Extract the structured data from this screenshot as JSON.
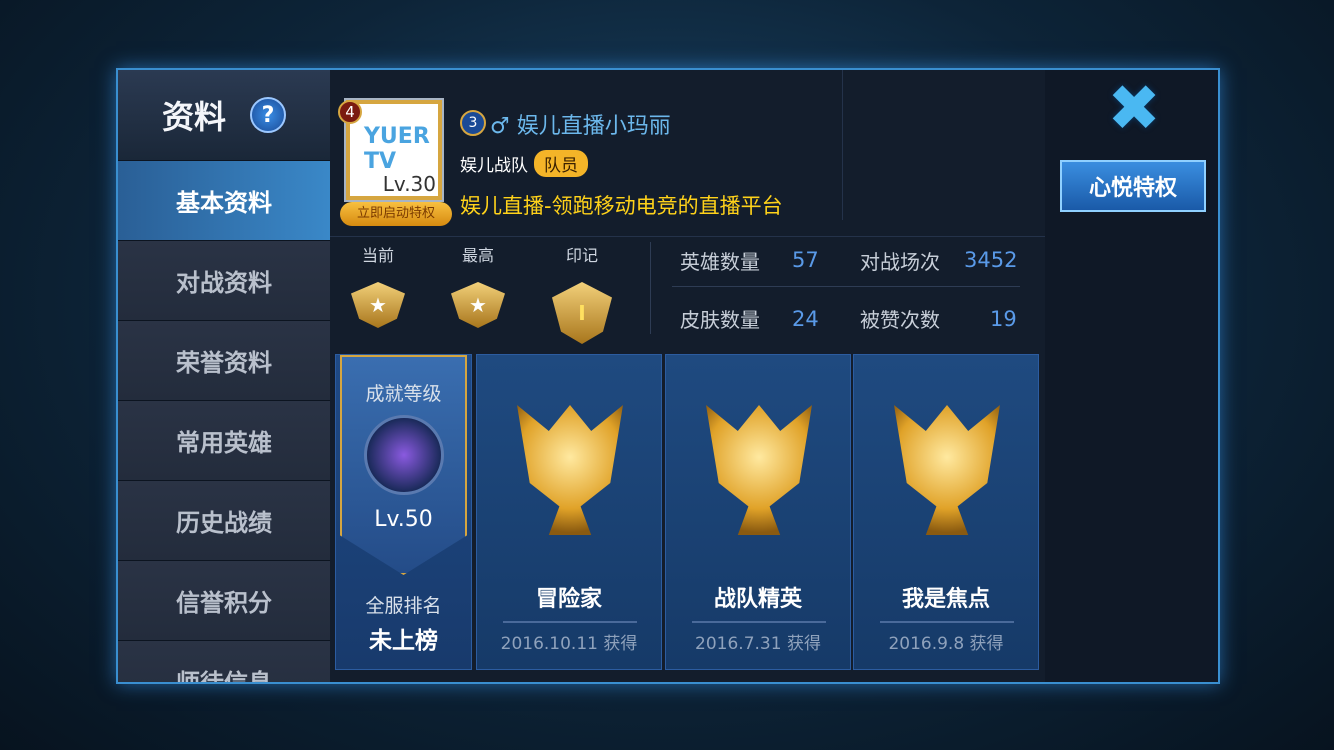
{
  "sidebar": {
    "title": "资料",
    "help": "?",
    "items": [
      {
        "label": "基本资料",
        "active": true
      },
      {
        "label": "对战资料"
      },
      {
        "label": "荣誉资料"
      },
      {
        "label": "常用英雄"
      },
      {
        "label": "历史战绩"
      },
      {
        "label": "信誉积分"
      },
      {
        "label": "师徒信息"
      }
    ]
  },
  "profile": {
    "avatar_logo": "YUER TV",
    "rank_badge": "4",
    "level": "Lv.30",
    "privilege_button": "立即启动特权",
    "vip_level": "3",
    "gender_icon": "♂",
    "name": "娱儿直播小玛丽",
    "team": "娱儿战队",
    "team_role": "队员",
    "motto": "娱儿直播-领跑移动电竞的直播平台"
  },
  "ranks": {
    "current_label": "当前",
    "highest_label": "最高",
    "mark_label": "印记",
    "mark_value": "I"
  },
  "stats": {
    "heroes_label": "英雄数量",
    "heroes": "57",
    "skins_label": "皮肤数量",
    "skins": "24",
    "matches_label": "对战场次",
    "matches": "3452",
    "likes_label": "被赞次数",
    "likes": "19"
  },
  "achievement": {
    "title": "成就等级",
    "level": "Lv.50",
    "rank_label": "全服排名",
    "rank_value": "未上榜"
  },
  "cards": [
    {
      "name": "冒险家",
      "date": "2016.10.11 获得"
    },
    {
      "name": "战队精英",
      "date": "2016.7.31 获得"
    },
    {
      "name": "我是焦点",
      "date": "2016.9.8 获得"
    }
  ],
  "right": {
    "close": "✖",
    "xinyue": "心悦特权"
  },
  "colors": {
    "accent": "#3a8fd0",
    "motto": "#ffd21a",
    "name": "#6cb8ec",
    "stat_value": "#5a9ae8"
  }
}
